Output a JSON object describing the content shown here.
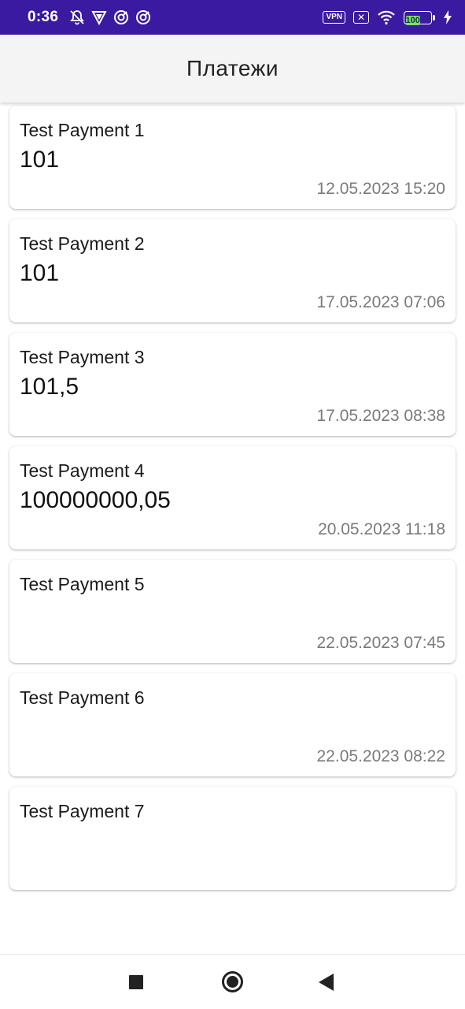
{
  "status_bar": {
    "time": "0:36",
    "left_icons": [
      "notifications-off-icon",
      "vpn-shield-icon",
      "sync-icon",
      "sync-icon"
    ],
    "vpn_label": "VPN",
    "battery_level": "100",
    "colors": {
      "background": "#3a1aa0",
      "battery_fill": "#7be06a"
    }
  },
  "app_bar": {
    "title": "Платежи"
  },
  "payments": [
    {
      "name": "Test Payment 1",
      "amount": "101",
      "date": "12.05.2023 15:20"
    },
    {
      "name": "Test Payment 2",
      "amount": "101",
      "date": "17.05.2023 07:06"
    },
    {
      "name": "Test Payment 3",
      "amount": "101,5",
      "date": "17.05.2023 08:38"
    },
    {
      "name": "Test Payment 4",
      "amount": "100000000,05",
      "date": "20.05.2023 11:18"
    },
    {
      "name": "Test Payment 5",
      "amount": "",
      "date": "22.05.2023 07:45"
    },
    {
      "name": "Test Payment 6",
      "amount": "",
      "date": "22.05.2023 08:22"
    },
    {
      "name": "Test Payment 7",
      "amount": "",
      "date": ""
    }
  ],
  "nav_bar": {
    "icons": [
      "recents-square-icon",
      "home-circle-icon",
      "back-triangle-icon"
    ]
  }
}
